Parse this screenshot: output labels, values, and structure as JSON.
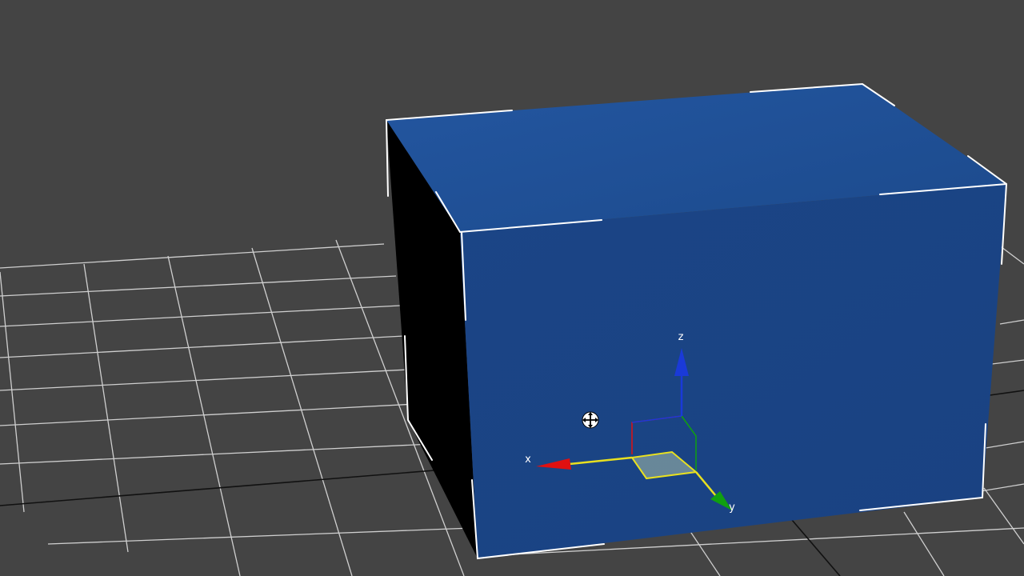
{
  "viewport": {
    "background_color": "#444444",
    "grid_color": "#e8e8e8",
    "grid_axis_color": "#111111"
  },
  "box": {
    "top_face_color": "#1e4b8f",
    "front_face_color": "#1a4586",
    "left_face_color": "#000000",
    "selection_bracket_color": "#ffffff"
  },
  "gizmo": {
    "x_label": "x",
    "y_label": "y",
    "z_label": "z",
    "x_color": "#e01010",
    "y_color": "#10a010",
    "z_color": "#1a3ad8",
    "plane_color": "#e8e020",
    "tool": "move-transform-gizmo"
  },
  "cursor": {
    "icon": "move-cursor-icon"
  }
}
